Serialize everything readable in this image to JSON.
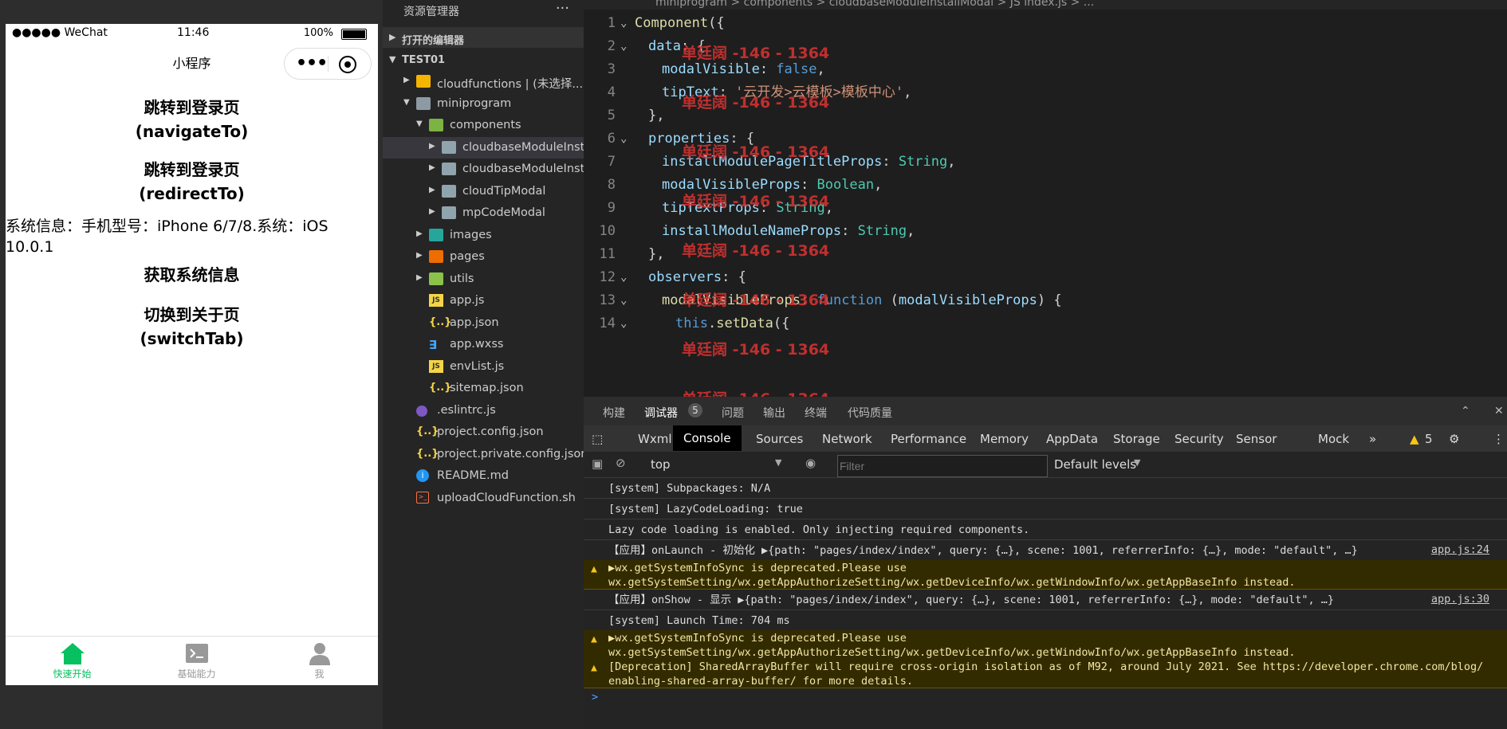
{
  "phone": {
    "carrier": "●●●●● WeChat",
    "time": "11:46",
    "battery": "100%",
    "nav_title": "小程序",
    "buttons": [
      {
        "line1": "跳转到登录页",
        "line2": "(navigateTo)"
      },
      {
        "line1": "跳转到登录页",
        "line2": "(redirectTo)"
      }
    ],
    "sysinfo": "系统信息：手机型号：iPhone 6/7/8.系统：iOS 10.0.1",
    "get_info_btn": "获取系统信息",
    "switch_btn": {
      "line1": "切换到关于页",
      "line2": "(switchTab)"
    },
    "tabs": [
      {
        "label": "快速开始",
        "color": "#07c160"
      },
      {
        "label": "基础能力",
        "color": "#999999"
      },
      {
        "label": "我",
        "color": "#999999"
      }
    ]
  },
  "explorer": {
    "header": "资源管理器",
    "more": "···",
    "open_editors": "打开的编辑器",
    "project": "TEST01",
    "items": [
      {
        "label": "cloudfunctions | (未选择...",
        "indent": 1,
        "kind": "folder-cf",
        "arrow": "▶"
      },
      {
        "label": "miniprogram",
        "indent": 1,
        "kind": "folder-mp",
        "arrow": "▼"
      },
      {
        "label": "components",
        "indent": 2,
        "kind": "folder-cp",
        "arrow": "▼"
      },
      {
        "label": "cloudbaseModuleInst...",
        "indent": 3,
        "kind": "folder",
        "arrow": "▶",
        "selected": true
      },
      {
        "label": "cloudbaseModuleInst...",
        "indent": 3,
        "kind": "folder",
        "arrow": "▶"
      },
      {
        "label": "cloudTipModal",
        "indent": 3,
        "kind": "folder",
        "arrow": "▶"
      },
      {
        "label": "mpCodeModal",
        "indent": 3,
        "kind": "folder",
        "arrow": "▶"
      },
      {
        "label": "images",
        "indent": 2,
        "kind": "folder-im",
        "arrow": "▶"
      },
      {
        "label": "pages",
        "indent": 2,
        "kind": "folder-pg",
        "arrow": "▶"
      },
      {
        "label": "utils",
        "indent": 2,
        "kind": "folder-ut",
        "arrow": "▶"
      },
      {
        "label": "app.js",
        "indent": 2,
        "kind": "js",
        "arrow": ""
      },
      {
        "label": "app.json",
        "indent": 2,
        "kind": "json",
        "arrow": ""
      },
      {
        "label": "app.wxss",
        "indent": 2,
        "kind": "css",
        "arrow": ""
      },
      {
        "label": "envList.js",
        "indent": 2,
        "kind": "js",
        "arrow": ""
      },
      {
        "label": "sitemap.json",
        "indent": 2,
        "kind": "json",
        "arrow": ""
      },
      {
        "label": ".eslintrc.js",
        "indent": 1,
        "kind": "dot",
        "arrow": ""
      },
      {
        "label": "project.config.json",
        "indent": 1,
        "kind": "json",
        "arrow": ""
      },
      {
        "label": "project.private.config.json",
        "indent": 1,
        "kind": "json",
        "arrow": ""
      },
      {
        "label": "README.md",
        "indent": 1,
        "kind": "info",
        "arrow": ""
      },
      {
        "label": "uploadCloudFunction.sh",
        "indent": 1,
        "kind": "sh",
        "arrow": ""
      }
    ]
  },
  "editor": {
    "breadcrumb": "miniprogram  >  components  >  cloudbaseModuleInstallModal  >  JS index.js  >  ...",
    "watermark": "单廷阔 -146 - 1364",
    "lines": [
      {
        "n": "1",
        "fold": "⌄",
        "indent": 0,
        "parts": [
          [
            "k",
            "Component"
          ],
          [
            "w",
            "({"
          ]
        ]
      },
      {
        "n": "2",
        "fold": "⌄",
        "indent": 1,
        "parts": [
          [
            "p",
            "data"
          ],
          [
            "w",
            ": {"
          ]
        ]
      },
      {
        "n": "3",
        "fold": "",
        "indent": 2,
        "parts": [
          [
            "p",
            "modalVisible"
          ],
          [
            "w",
            ": "
          ],
          [
            "kw",
            "false"
          ],
          [
            "w",
            ","
          ]
        ]
      },
      {
        "n": "4",
        "fold": "",
        "indent": 2,
        "parts": [
          [
            "p",
            "tipText"
          ],
          [
            "w",
            ": "
          ],
          [
            "s",
            "'云开发>云模板>模板中心'"
          ],
          [
            "w",
            ","
          ]
        ]
      },
      {
        "n": "5",
        "fold": "",
        "indent": 1,
        "parts": [
          [
            "w",
            "},"
          ]
        ]
      },
      {
        "n": "6",
        "fold": "⌄",
        "indent": 1,
        "parts": [
          [
            "p",
            "properties"
          ],
          [
            "w",
            ": {"
          ]
        ]
      },
      {
        "n": "7",
        "fold": "",
        "indent": 2,
        "parts": [
          [
            "p",
            "installModulePageTitleProps"
          ],
          [
            "w",
            ": "
          ],
          [
            "t",
            "String"
          ],
          [
            "w",
            ","
          ]
        ]
      },
      {
        "n": "8",
        "fold": "",
        "indent": 2,
        "parts": [
          [
            "p",
            "modalVisibleProps"
          ],
          [
            "w",
            ": "
          ],
          [
            "t",
            "Boolean"
          ],
          [
            "w",
            ","
          ]
        ]
      },
      {
        "n": "9",
        "fold": "",
        "indent": 2,
        "parts": [
          [
            "p",
            "tipTextProps"
          ],
          [
            "w",
            ": "
          ],
          [
            "t",
            "String"
          ],
          [
            "w",
            ","
          ]
        ]
      },
      {
        "n": "10",
        "fold": "",
        "indent": 2,
        "parts": [
          [
            "p",
            "installModuleNameProps"
          ],
          [
            "w",
            ": "
          ],
          [
            "t",
            "String"
          ],
          [
            "w",
            ","
          ]
        ]
      },
      {
        "n": "11",
        "fold": "",
        "indent": 1,
        "parts": [
          [
            "w",
            "},"
          ]
        ]
      },
      {
        "n": "12",
        "fold": "⌄",
        "indent": 1,
        "parts": [
          [
            "p",
            "observers"
          ],
          [
            "w",
            ": {"
          ]
        ]
      },
      {
        "n": "13",
        "fold": "⌄",
        "indent": 2,
        "parts": [
          [
            "k",
            "modalVisibleProps"
          ],
          [
            "w",
            ": "
          ],
          [
            "kw",
            "function"
          ],
          [
            "w",
            " ("
          ],
          [
            "p",
            "modalVisibleProps"
          ],
          [
            "w",
            ") {"
          ]
        ]
      },
      {
        "n": "14",
        "fold": "⌄",
        "indent": 3,
        "parts": [
          [
            "kw",
            "this"
          ],
          [
            "w",
            "."
          ],
          [
            "k",
            "setData"
          ],
          [
            "w",
            "({"
          ]
        ]
      }
    ]
  },
  "devtools": {
    "top_tabs": [
      "构建",
      "调试器",
      "问题",
      "输出",
      "终端",
      "代码质量"
    ],
    "top_badge": "5",
    "tabs": [
      "Wxml",
      "Console",
      "Sources",
      "Network",
      "Performance",
      "Memory",
      "AppData",
      "Storage",
      "Security",
      "Sensor",
      "Mock"
    ],
    "warn_count": "5",
    "context": "top",
    "filter_placeholder": "Filter",
    "levels": "Default levels",
    "logs": [
      {
        "type": "log",
        "text": "[system] Subpackages: N/A",
        "src": ""
      },
      {
        "type": "log",
        "text": "[system] LazyCodeLoading: true",
        "src": ""
      },
      {
        "type": "log",
        "text": "Lazy code loading is enabled. Only injecting required components.",
        "src": ""
      },
      {
        "type": "log",
        "text": "【应用】onLaunch - 初始化 ▶{path: \"pages/index/index\", query: {…}, scene: 1001, referrerInfo: {…}, mode: \"default\", …}",
        "src": "app.js:24"
      },
      {
        "type": "warn",
        "text": "▶wx.getSystemInfoSync is deprecated.Please use\nwx.getSystemSetting/wx.getAppAuthorizeSetting/wx.getDeviceInfo/wx.getWindowInfo/wx.getAppBaseInfo instead.",
        "src": ""
      },
      {
        "type": "log",
        "text": "【应用】onShow - 显示 ▶{path: \"pages/index/index\", query: {…}, scene: 1001, referrerInfo: {…}, mode: \"default\", …}",
        "src": "app.js:30"
      },
      {
        "type": "log",
        "text": "[system] Launch Time: 704 ms",
        "src": ""
      },
      {
        "type": "warn",
        "text": "▶wx.getSystemInfoSync is deprecated.Please use\nwx.getSystemSetting/wx.getAppAuthorizeSetting/wx.getDeviceInfo/wx.getWindowInfo/wx.getAppBaseInfo instead.",
        "src": ""
      },
      {
        "type": "warn",
        "text": "[Deprecation] SharedArrayBuffer will require cross-origin isolation as of M92, around July 2021. See https://developer.chrome.com/blog/\nenabling-shared-array-buffer/ for more details.",
        "src": ""
      }
    ],
    "prompt": ">"
  }
}
